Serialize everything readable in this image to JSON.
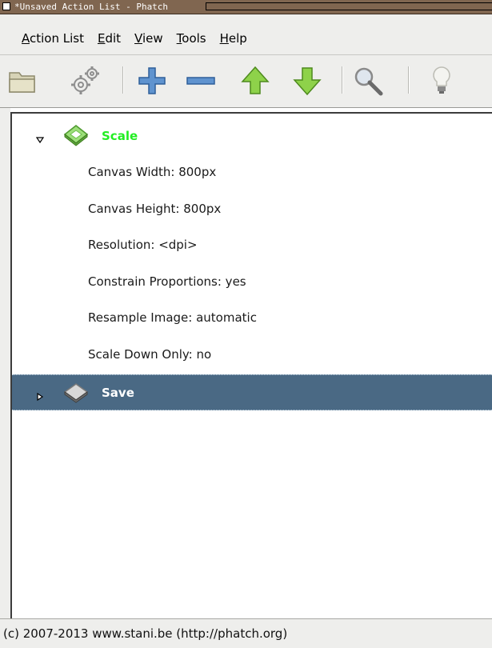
{
  "window": {
    "title": "*Unsaved Action List - Phatch"
  },
  "menubar": {
    "items": [
      {
        "pre": "",
        "mnemonic": "A",
        "post": "ction List"
      },
      {
        "pre": "",
        "mnemonic": "E",
        "post": "dit"
      },
      {
        "pre": "",
        "mnemonic": "V",
        "post": "iew"
      },
      {
        "pre": "",
        "mnemonic": "T",
        "post": "ools"
      },
      {
        "pre": "",
        "mnemonic": "H",
        "post": "elp"
      }
    ]
  },
  "toolbar": {
    "icons": [
      "folder-open-icon",
      "gears-icon",
      "plus-icon",
      "minus-icon",
      "arrow-up-icon",
      "arrow-down-icon",
      "magnifier-icon",
      "lightbulb-icon"
    ]
  },
  "tree": {
    "actions": [
      {
        "label": "Scale",
        "expanded": true,
        "label_color": "#22ee22",
        "properties": [
          "Canvas Width: 800px",
          "Canvas Height: 800px",
          "Resolution: <dpi>",
          "Constrain Proportions: yes",
          "Resample Image: automatic",
          "Scale Down Only: no"
        ]
      },
      {
        "label": "Save",
        "expanded": false,
        "selected": true,
        "label_color": "#ffffff",
        "properties": []
      }
    ]
  },
  "status": {
    "text": "(c) 2007-2013 www.stani.be (http://phatch.org)"
  },
  "colors": {
    "titlebar": "#806650",
    "selection": "#4a6984",
    "scale_label": "#22ee22"
  }
}
